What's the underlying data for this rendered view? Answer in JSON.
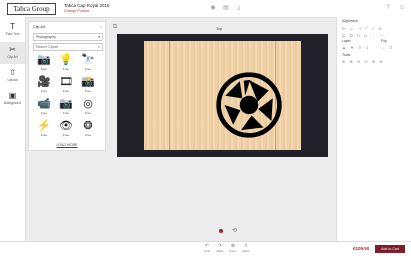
{
  "header": {
    "logo_text": "Tabca Group",
    "product_title": "Tabca Cap Royal 2016",
    "product_subtitle": "Change Product",
    "icons": [
      "view-icon",
      "document-icon",
      "download-icon",
      "help-icon",
      "user-icon"
    ]
  },
  "leftnav": {
    "items": [
      {
        "label": "Plain Text",
        "icon": "text-icon"
      },
      {
        "label": "Clip Art",
        "icon": "clipart-icon",
        "active": true
      },
      {
        "label": "Upload",
        "icon": "upload-icon"
      },
      {
        "label": "Background",
        "icon": "background-icon"
      }
    ]
  },
  "clipart": {
    "title": "Clip Art",
    "category": "Photography",
    "search_placeholder": "Search Clipart",
    "price_label": "Free",
    "items": [
      {
        "icon": "camera-icon",
        "glyph": "📷"
      },
      {
        "icon": "tripod-light-icon",
        "glyph": "💡"
      },
      {
        "icon": "tripod-icon",
        "glyph": "🔭"
      },
      {
        "icon": "reel-camera-icon",
        "glyph": "🎥"
      },
      {
        "icon": "film-icon",
        "glyph": "🎞"
      },
      {
        "icon": "vintage-camera-icon",
        "glyph": "📸"
      },
      {
        "icon": "video-camera-icon",
        "glyph": "📹"
      },
      {
        "icon": "slr-camera-icon",
        "glyph": "📷"
      },
      {
        "icon": "lens-icon",
        "glyph": "◎"
      },
      {
        "icon": "flash-icon",
        "glyph": "⚡"
      },
      {
        "icon": "eye-icon",
        "glyph": "👁"
      },
      {
        "icon": "shutter-icon",
        "glyph": "❂"
      }
    ],
    "load_more": "LOAD MORE"
  },
  "canvas": {
    "view_label": "Top"
  },
  "rightpanel": {
    "alignment_label": "Alignment",
    "layer_label": "Layer",
    "flip_label": "Flip",
    "tools_label": "Tools"
  },
  "bottombar": {
    "tools": [
      {
        "label": "Undo",
        "icon": "undo-icon",
        "glyph": "↶"
      },
      {
        "label": "Redo",
        "icon": "redo-icon",
        "glyph": "↷"
      },
      {
        "label": "Zoom",
        "icon": "zoom-icon",
        "glyph": "⊕"
      },
      {
        "label": "Share",
        "icon": "share-icon",
        "glyph": "⇪"
      }
    ],
    "price": "€109.50",
    "add_to_cart": "Add to Cart"
  },
  "colors": {
    "accent": "#7e1d2b",
    "price": "#b0202b"
  }
}
